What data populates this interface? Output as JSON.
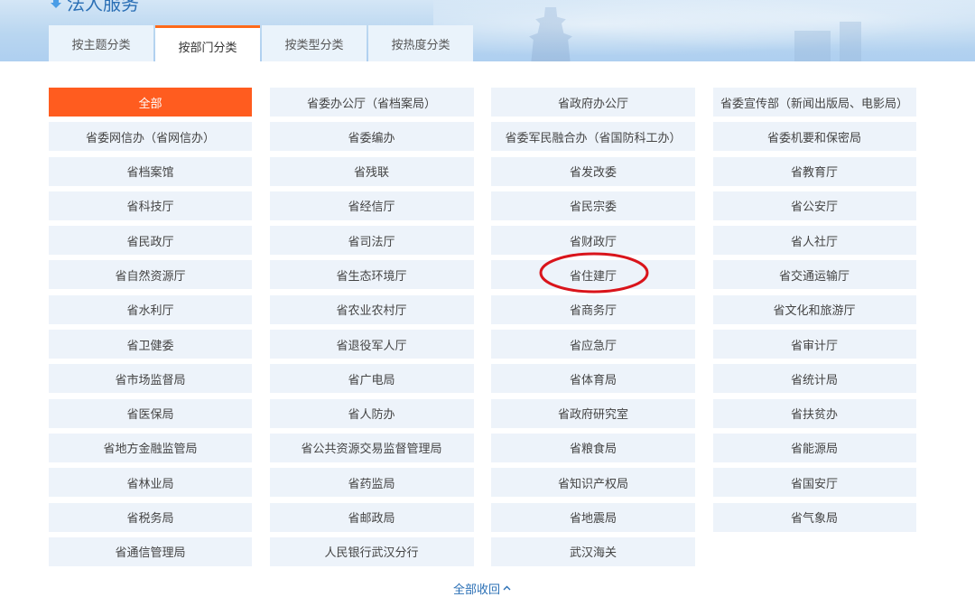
{
  "header": {
    "title": "法人服务"
  },
  "tabs": [
    {
      "label": "按主题分类",
      "active": false
    },
    {
      "label": "按部门分类",
      "active": true
    },
    {
      "label": "按类型分类",
      "active": false
    },
    {
      "label": "按热度分类",
      "active": false
    }
  ],
  "departments": [
    "全部",
    "省委办公厅（省档案局）",
    "省政府办公厅",
    "省委宣传部（新闻出版局、电影局）",
    "省委网信办（省网信办）",
    "省委编办",
    "省委军民融合办（省国防科工办）",
    "省委机要和保密局",
    "省档案馆",
    "省残联",
    "省发改委",
    "省教育厅",
    "省科技厅",
    "省经信厅",
    "省民宗委",
    "省公安厅",
    "省民政厅",
    "省司法厅",
    "省财政厅",
    "省人社厅",
    "省自然资源厅",
    "省生态环境厅",
    "省住建厅",
    "省交通运输厅",
    "省水利厅",
    "省农业农村厅",
    "省商务厅",
    "省文化和旅游厅",
    "省卫健委",
    "省退役军人厅",
    "省应急厅",
    "省审计厅",
    "省市场监督局",
    "省广电局",
    "省体育局",
    "省统计局",
    "省医保局",
    "省人防办",
    "省政府研究室",
    "省扶贫办",
    "省地方金融监管局",
    "省公共资源交易监督管理局",
    "省粮食局",
    "省能源局",
    "省林业局",
    "省药监局",
    "省知识产权局",
    "省国安厅",
    "省税务局",
    "省邮政局",
    "省地震局",
    "省气象局",
    "省通信管理局",
    "人民银行武汉分行",
    "武汉海关"
  ],
  "active_department": "全部",
  "highlighted_department": "省住建厅",
  "footer": {
    "collapse_label": "全部收回"
  },
  "colors": {
    "accent": "#ff5c1f",
    "tab_active_border": "#ff6a1a",
    "cell_bg": "#edf3fa",
    "link": "#2a6fb5",
    "annotation": "#d9141b"
  }
}
